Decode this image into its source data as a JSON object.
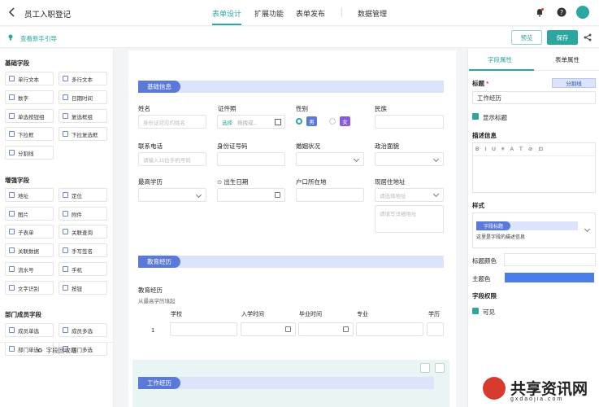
{
  "header": {
    "title": "员工入职登记",
    "tabs": [
      "表单设计",
      "扩展功能",
      "表单发布",
      "数据管理"
    ]
  },
  "subbar": {
    "guide": "查看新手引导",
    "preview": "预览",
    "save": "保存"
  },
  "left": {
    "basic_title": "基础字段",
    "basic": [
      "单行文本",
      "多行文本",
      "数字",
      "日期时间",
      "单选按钮组",
      "复选框组",
      "下拉框",
      "下拉复选框",
      "分割线"
    ],
    "enhanced_title": "增强字段",
    "enhanced": [
      "地址",
      "定位",
      "图片",
      "附件",
      "子表单",
      "关联查询",
      "关联数据",
      "手写签名",
      "流水号",
      "手机",
      "文字识别",
      "按钮"
    ],
    "dept_title": "部门成员字段",
    "dept": [
      "成员单选",
      "成员多选",
      "部门单选",
      "部门多选"
    ],
    "recycle": "字段回收站"
  },
  "form": {
    "section1": "基础信息",
    "name_label": "姓名",
    "name_ph": "身份证对应的姓名",
    "idphoto_label": "证件照",
    "idphoto_select": "选择",
    "idphoto_drag": "拖拽或...",
    "gender_label": "性别",
    "gender_male": "男",
    "gender_female": "女",
    "nation_label": "民族",
    "phone_label": "联系电话",
    "phone_ph": "请输入11位手机号码",
    "idno_label": "身份证号码",
    "marital_label": "婚姻状况",
    "political_label": "政治面貌",
    "edu_label": "最高学历",
    "birth_label": "出生日期",
    "hukou_label": "户口所在地",
    "addr_label": "现居住地址",
    "addr_ph": "请选择地址",
    "addr_detail_ph": "请填写详细地址",
    "section2": "教育经历",
    "edu_title": "教育经历",
    "edu_desc": "从最高学历填起",
    "table_headers": [
      "学校",
      "入学时间",
      "毕业时间",
      "专业",
      "学历"
    ],
    "row_no": "1",
    "section3": "工作经历"
  },
  "right": {
    "tab_field": "字段属性",
    "tab_form": "表单属性",
    "title_label": "标题",
    "required_mark": "*",
    "divider_tag": "分割线",
    "title_value": "工作经历",
    "show_title": "显示标题",
    "desc_label": "描述信息",
    "rte_tools": [
      "B",
      "I",
      "U",
      "≡",
      "A",
      "T",
      "⊘",
      "⊡"
    ],
    "style_label": "样式",
    "style_tag": "字段标题",
    "style_desc": "这里是字段的描述信息",
    "title_color": "标题颜色",
    "theme_color": "主题色",
    "perm_label": "字段权限",
    "visible": "可见"
  },
  "watermark": {
    "text": "共享资讯网",
    "sub": "gxdaojia.com"
  },
  "colors": {
    "accent": "#2ba7a0",
    "section": "#5b79d9",
    "theme": "#4a7de8"
  }
}
